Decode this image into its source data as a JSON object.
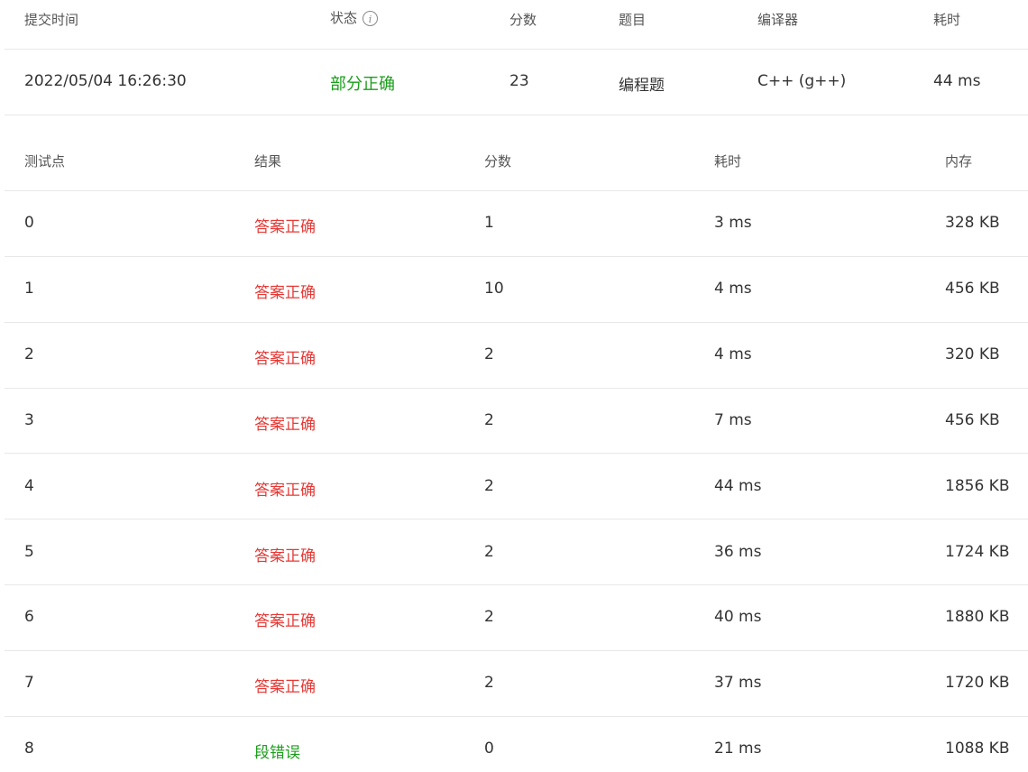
{
  "submission": {
    "headers": {
      "submit_time": "提交时间",
      "status": "状态",
      "score": "分数",
      "problem": "题目",
      "compiler": "编译器",
      "time": "耗时"
    },
    "row": {
      "submit_time": "2022/05/04 16:26:30",
      "status": "部分正确",
      "score": "23",
      "problem": "编程题",
      "compiler": "C++ (g++)",
      "time": "44 ms"
    }
  },
  "testcases": {
    "headers": {
      "case": "测试点",
      "result": "结果",
      "score": "分数",
      "time": "耗时",
      "memory": "内存"
    },
    "rows": [
      {
        "case": "0",
        "result": "答案正确",
        "score": "1",
        "time": "3 ms",
        "memory": "328 KB"
      },
      {
        "case": "1",
        "result": "答案正确",
        "score": "10",
        "time": "4 ms",
        "memory": "456 KB"
      },
      {
        "case": "2",
        "result": "答案正确",
        "score": "2",
        "time": "4 ms",
        "memory": "320 KB"
      },
      {
        "case": "3",
        "result": "答案正确",
        "score": "2",
        "time": "7 ms",
        "memory": "456 KB"
      },
      {
        "case": "4",
        "result": "答案正确",
        "score": "2",
        "time": "44 ms",
        "memory": "1856 KB"
      },
      {
        "case": "5",
        "result": "答案正确",
        "score": "2",
        "time": "36 ms",
        "memory": "1724 KB"
      },
      {
        "case": "6",
        "result": "答案正确",
        "score": "2",
        "time": "40 ms",
        "memory": "1880 KB"
      },
      {
        "case": "7",
        "result": "答案正确",
        "score": "2",
        "time": "37 ms",
        "memory": "1720 KB"
      },
      {
        "case": "8",
        "result": "段错误",
        "score": "0",
        "time": "21 ms",
        "memory": "1088 KB"
      }
    ]
  },
  "colors": {
    "partial_correct": "#1a9e1a",
    "accepted": "#e53935",
    "segfault": "#1a9e1a"
  },
  "icons": {
    "status_info": "info-icon"
  }
}
